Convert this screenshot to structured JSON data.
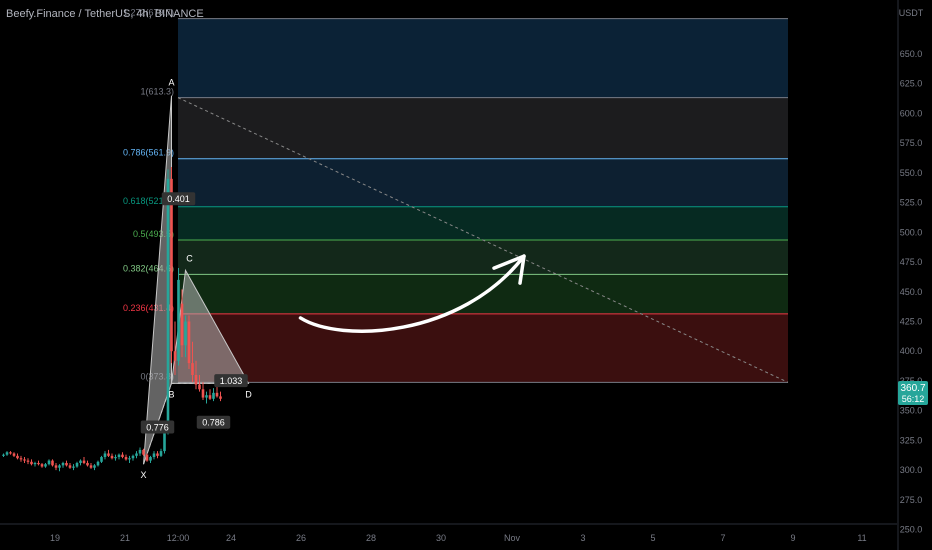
{
  "header": {
    "symbol_title": "Beefy.Finance / TetherUS, 4h, BINANCE"
  },
  "colors": {
    "background": "#000000",
    "up": "#26a69a",
    "down": "#ef5350",
    "axis_text": "#787b86",
    "fib_levels": [
      "#787b86",
      "#f23645",
      "#81c784",
      "#4caf50",
      "#089981",
      "#64b5f6",
      "#787b86",
      "#787b86"
    ]
  },
  "chart_data": {
    "type": "candlestick",
    "price_scale": {
      "unit": "USDT",
      "ylim": [
        245,
        695
      ],
      "ticks": [
        650.0,
        625.0,
        600.0,
        575.0,
        550.0,
        525.0,
        500.0,
        475.0,
        450.0,
        425.0,
        400.0,
        375.0,
        350.0,
        325.0,
        300.0,
        275.0,
        250.0
      ],
      "tick_labels": [
        "650.0",
        "625.0",
        "600.0",
        "575.0",
        "550.0",
        "525.0",
        "500.0",
        "475.0",
        "450.0",
        "425.0",
        "400.0",
        "375.0",
        "350.0",
        "325.0",
        "300.0",
        "275.0",
        "250.0"
      ],
      "current_price": "360.7",
      "countdown": "56:12"
    },
    "time_scale": {
      "labels": [
        "19",
        "21",
        "12:00",
        "24",
        "26",
        "28",
        "30",
        "Nov",
        "3",
        "5",
        "7",
        "9",
        "11"
      ]
    },
    "candles": [
      [
        312,
        314,
        311,
        313
      ],
      [
        313,
        316,
        312,
        315
      ],
      [
        315,
        316,
        313,
        314
      ],
      [
        314,
        315,
        311,
        312
      ],
      [
        312,
        314,
        309,
        310
      ],
      [
        310,
        312,
        307,
        309
      ],
      [
        309,
        311,
        306,
        308
      ],
      [
        308,
        310,
        305,
        307
      ],
      [
        307,
        309,
        304,
        305
      ],
      [
        305,
        307,
        303,
        306
      ],
      [
        306,
        308,
        304,
        305
      ],
      [
        305,
        306,
        302,
        303
      ],
      [
        303,
        306,
        302,
        305
      ],
      [
        305,
        309,
        304,
        308
      ],
      [
        308,
        309,
        303,
        304
      ],
      [
        304,
        306,
        300,
        302
      ],
      [
        302,
        305,
        299,
        304
      ],
      [
        304,
        307,
        302,
        306
      ],
      [
        306,
        308,
        303,
        304
      ],
      [
        304,
        306,
        301,
        302
      ],
      [
        302,
        305,
        300,
        303
      ],
      [
        303,
        307,
        302,
        306
      ],
      [
        306,
        309,
        304,
        308
      ],
      [
        308,
        311,
        305,
        306
      ],
      [
        306,
        308,
        303,
        304
      ],
      [
        304,
        306,
        301,
        302
      ],
      [
        302,
        305,
        300,
        304
      ],
      [
        304,
        308,
        303,
        307
      ],
      [
        307,
        312,
        306,
        311
      ],
      [
        311,
        316,
        309,
        314
      ],
      [
        314,
        317,
        311,
        312
      ],
      [
        312,
        314,
        309,
        310
      ],
      [
        310,
        313,
        308,
        311
      ],
      [
        311,
        314,
        309,
        313
      ],
      [
        313,
        315,
        310,
        311
      ],
      [
        311,
        313,
        308,
        309
      ],
      [
        309,
        312,
        306,
        310
      ],
      [
        310,
        313,
        308,
        312
      ],
      [
        312,
        316,
        310,
        314
      ],
      [
        314,
        319,
        312,
        317
      ],
      [
        317,
        318,
        312,
        313
      ],
      [
        313,
        314,
        307,
        308
      ],
      [
        308,
        312,
        306,
        311
      ],
      [
        311,
        316,
        309,
        314
      ],
      [
        314,
        316,
        310,
        312
      ],
      [
        312,
        318,
        311,
        316
      ],
      [
        316,
        340,
        314,
        335
      ],
      [
        335,
        553,
        330,
        545
      ],
      [
        545,
        555,
        390,
        400
      ],
      [
        400,
        425,
        380,
        392
      ],
      [
        392,
        470,
        388,
        460
      ],
      [
        440,
        452,
        395,
        405
      ],
      [
        405,
        430,
        395,
        425
      ],
      [
        425,
        430,
        385,
        390
      ],
      [
        390,
        408,
        374,
        380
      ],
      [
        380,
        392,
        368,
        372
      ],
      [
        372,
        380,
        366,
        368
      ],
      [
        368,
        374,
        359,
        361
      ],
      [
        361,
        366,
        356,
        363
      ],
      [
        363,
        368,
        359,
        360
      ],
      [
        360,
        369,
        358,
        365
      ],
      [
        365,
        370,
        361,
        362
      ],
      [
        362,
        366,
        358,
        360
      ]
    ],
    "fibonacci": {
      "levels": [
        {
          "ratio": "0",
          "label": "0(373.8)",
          "price": 373.8
        },
        {
          "ratio": "0.236",
          "label": "0.236(431.4)",
          "price": 431.4
        },
        {
          "ratio": "0.382",
          "label": "0.382(464.6)",
          "price": 464.6
        },
        {
          "ratio": "0.5",
          "label": "0.5(493.5)",
          "price": 493.5
        },
        {
          "ratio": "0.618",
          "label": "0.618(521.5)",
          "price": 521.5
        },
        {
          "ratio": "0.786",
          "label": "0.786(561.9)",
          "price": 561.9
        },
        {
          "ratio": "1",
          "label": "1(613.3)",
          "price": 613.3
        },
        {
          "ratio": "1.272",
          "label": "1.272(679.7)",
          "price": 679.7
        }
      ],
      "trend_start": {
        "bar": 47,
        "price": 613.3
      },
      "trend_end": {
        "bar": 166,
        "price": 373.8
      }
    },
    "xabcd_pattern": {
      "points": [
        {
          "label": "X",
          "bar": 40,
          "price": 305
        },
        {
          "label": "A",
          "bar": 48,
          "price": 615
        },
        {
          "label": "B",
          "bar": 48,
          "price": 373
        },
        {
          "label": "C",
          "bar": 52,
          "price": 468
        },
        {
          "label": "D",
          "bar": 70,
          "price": 373
        }
      ],
      "ratios": [
        {
          "text": "0.776",
          "bar": 44,
          "price": 335
        },
        {
          "text": "0.401",
          "bar": 50,
          "price": 527
        },
        {
          "text": "0.786",
          "bar": 60,
          "price": 339
        },
        {
          "text": "1.033",
          "bar": 65,
          "price": 374
        }
      ]
    },
    "drawn_arrow": {
      "from": {
        "bar": 82,
        "price": 428
      },
      "to": {
        "bar": 145,
        "price": 480
      }
    }
  }
}
